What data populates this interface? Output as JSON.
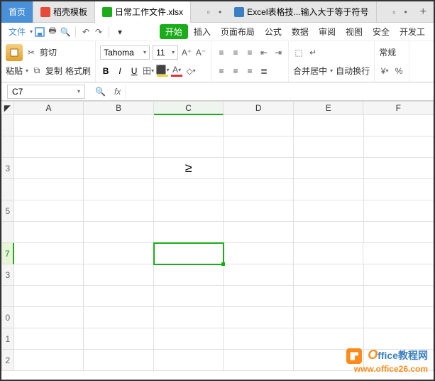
{
  "tabs": {
    "home": "首页",
    "t1": "稻壳模板",
    "t2": "日常工作文件.xlsx",
    "t3": "Excel表格技...输入大于等于符号",
    "plus": "+"
  },
  "menubar": {
    "file": "文件",
    "start": "开始",
    "insert": "插入",
    "pagelayout": "页面布局",
    "formula": "公式",
    "data": "数据",
    "review": "审阅",
    "view": "视图",
    "security": "安全",
    "dev": "开发工"
  },
  "ribbon": {
    "paste": "粘贴",
    "cut": "剪切",
    "copy": "复制",
    "formatpainter": "格式刷",
    "font": "Tahoma",
    "size": "11",
    "mergecenter": "合并居中",
    "wrap": "自动换行",
    "general": "常规",
    "percent": "%"
  },
  "fbar": {
    "cellref": "C7",
    "fx": "fx"
  },
  "columns": {
    "A": "A",
    "B": "B",
    "C": "C",
    "D": "D",
    "E": "E",
    "F": "F"
  },
  "rows": [
    "",
    "",
    "3",
    "",
    "5",
    "",
    "7",
    "3",
    "",
    "0",
    "1",
    "2"
  ],
  "cells": {
    "C3": "≥"
  },
  "watermark": {
    "brand1": "O",
    "brand2": "ffice教程网",
    "url": "www.office26.com"
  }
}
